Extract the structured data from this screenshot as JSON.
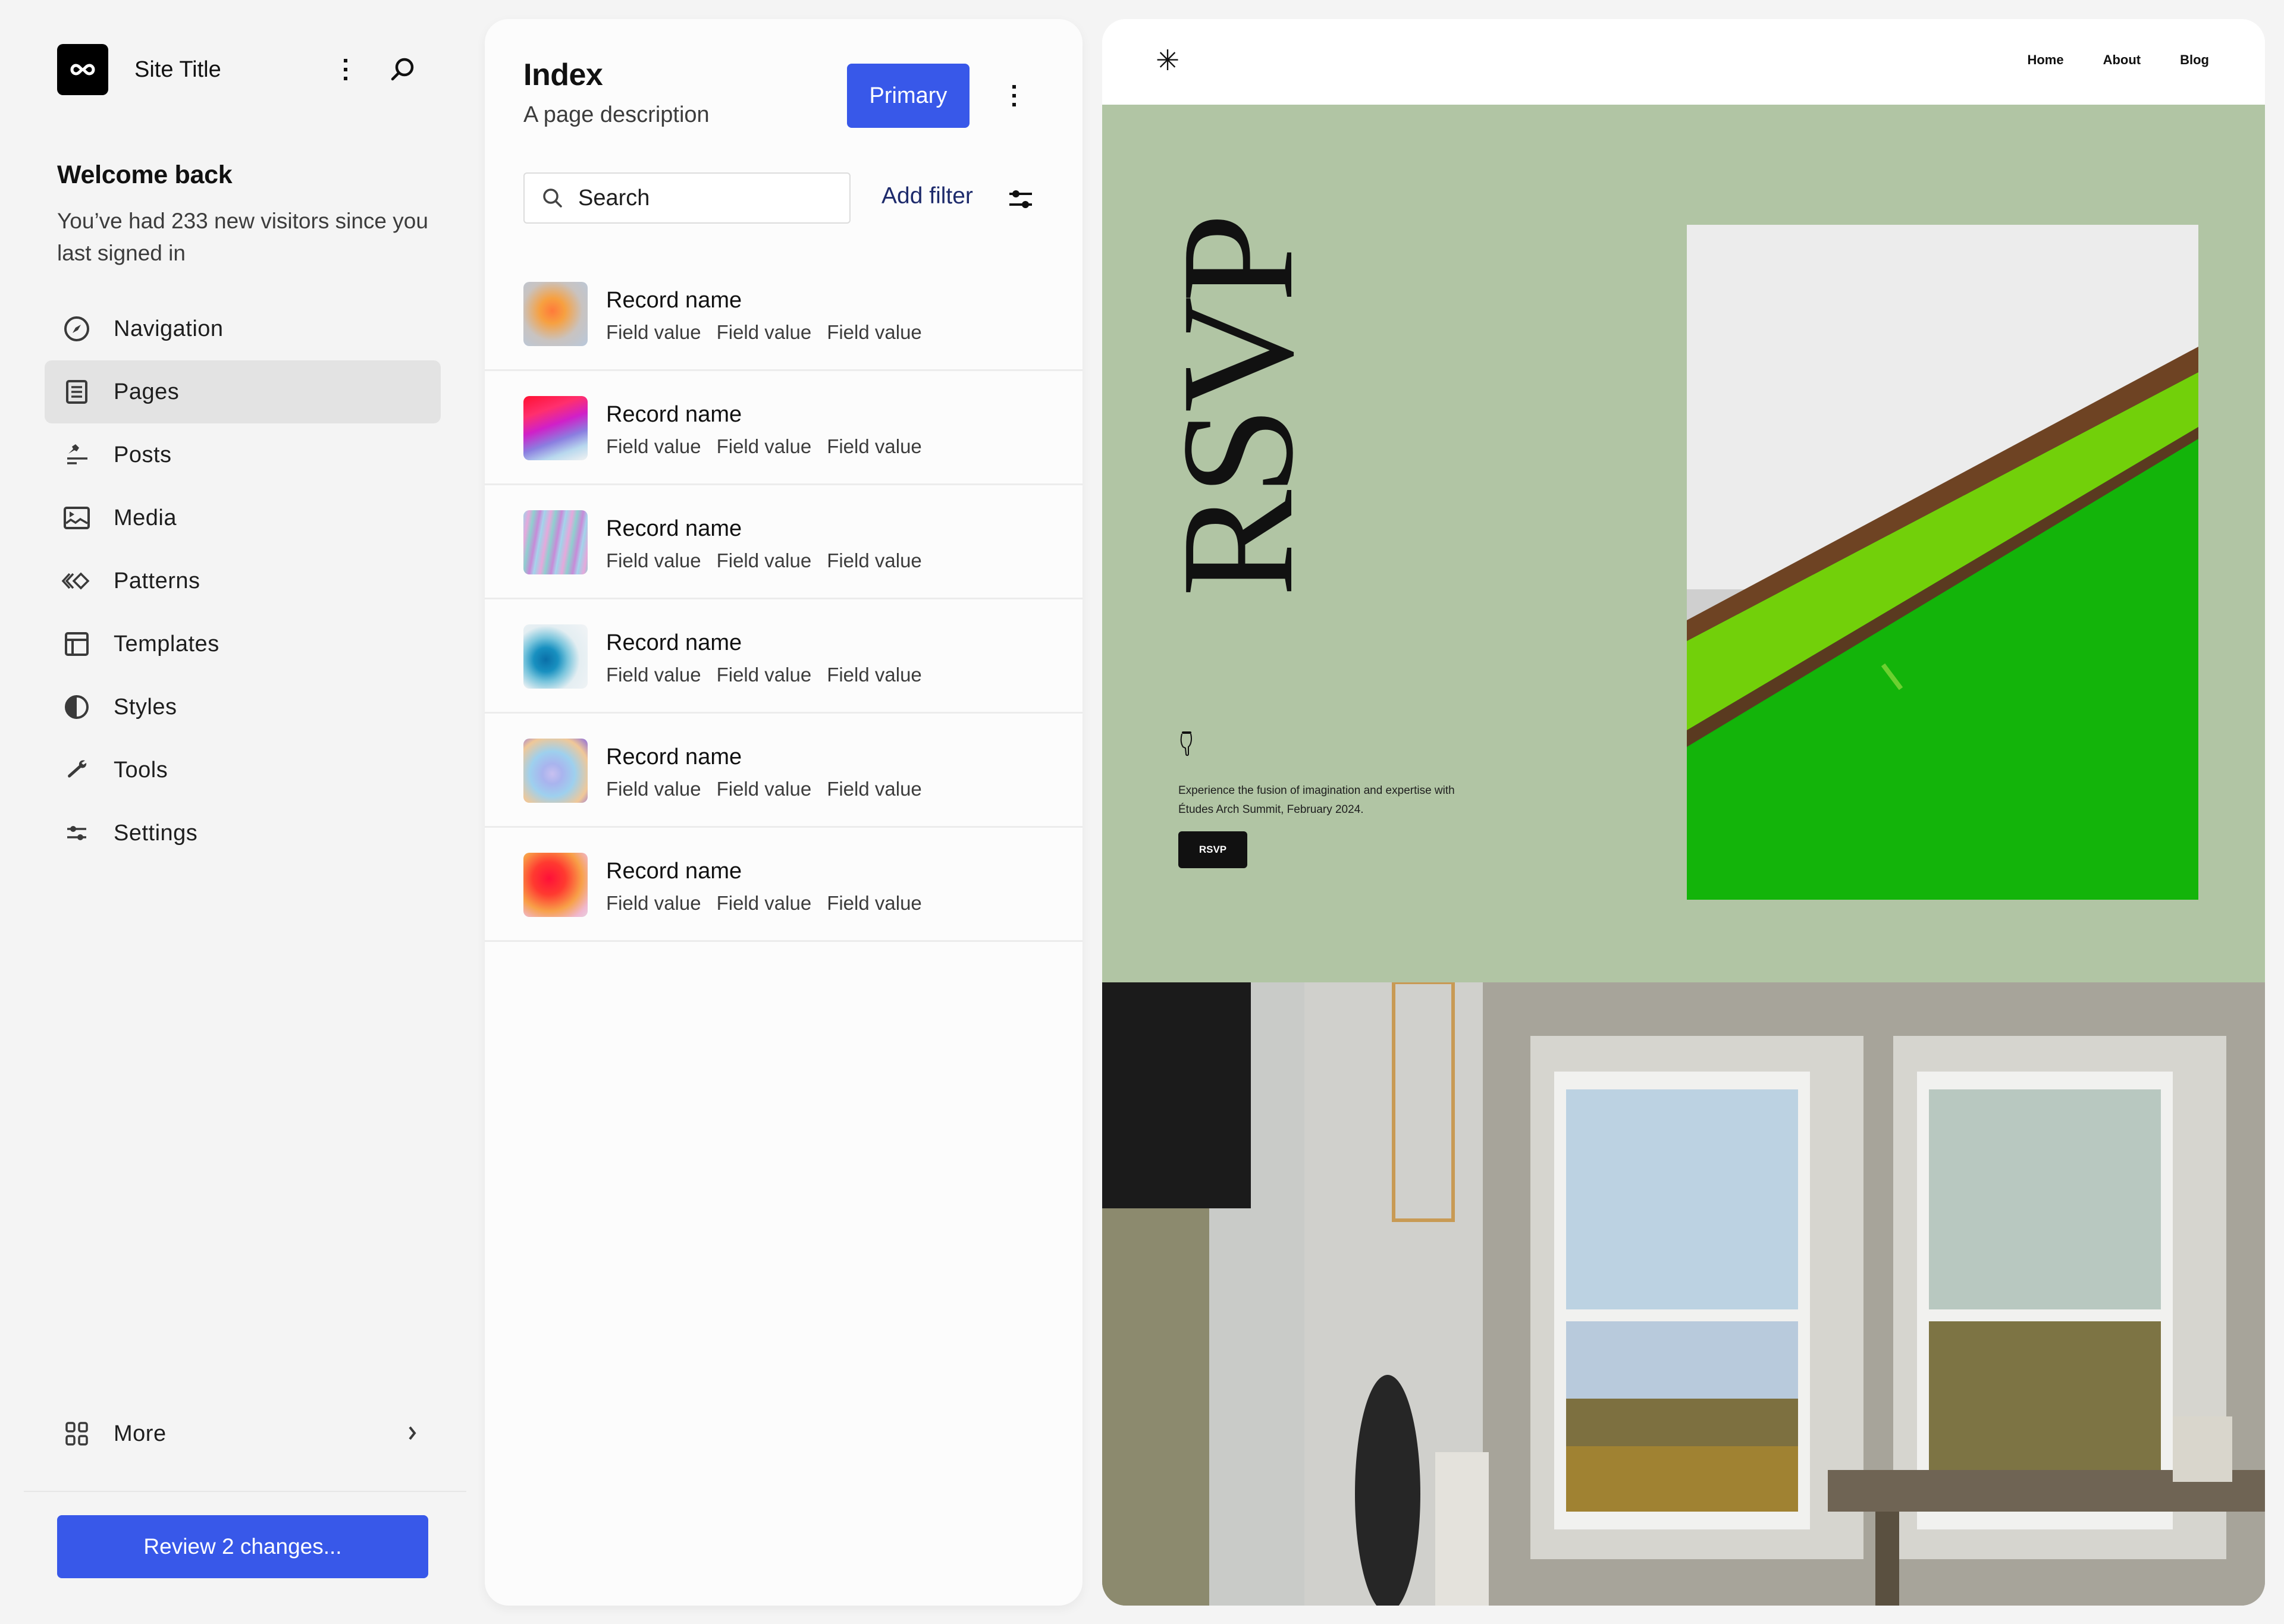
{
  "sidebar": {
    "site_title": "Site Title",
    "logo_icon": "infinity-icon",
    "welcome_title": "Welcome back",
    "welcome_text": "You’ve had 233 new visitors since you last signed in",
    "nav_items": [
      {
        "label": "Navigation",
        "icon": "compass-icon",
        "active": false
      },
      {
        "label": "Pages",
        "icon": "page-icon",
        "active": true
      },
      {
        "label": "Posts",
        "icon": "pin-icon",
        "active": false
      },
      {
        "label": "Media",
        "icon": "image-icon",
        "active": false
      },
      {
        "label": "Patterns",
        "icon": "symbol-icon",
        "active": false
      },
      {
        "label": "Templates",
        "icon": "layout-icon",
        "active": false
      },
      {
        "label": "Styles",
        "icon": "half-circle-icon",
        "active": false
      },
      {
        "label": "Tools",
        "icon": "wrench-icon",
        "active": false
      },
      {
        "label": "Settings",
        "icon": "sliders-icon",
        "active": false
      }
    ],
    "more_label": "More",
    "review_button": "Review 2 changes..."
  },
  "panel": {
    "title": "Index",
    "description": "A page description",
    "primary_button": "Primary",
    "search_placeholder": "Search",
    "search_value": "",
    "add_filter": "Add filter",
    "records": [
      {
        "name": "Record name",
        "fields": [
          "Field value",
          "Field value",
          "Field value"
        ]
      },
      {
        "name": "Record name",
        "fields": [
          "Field value",
          "Field value",
          "Field value"
        ]
      },
      {
        "name": "Record name",
        "fields": [
          "Field value",
          "Field value",
          "Field value"
        ]
      },
      {
        "name": "Record name",
        "fields": [
          "Field value",
          "Field value",
          "Field value"
        ]
      },
      {
        "name": "Record name",
        "fields": [
          "Field value",
          "Field value",
          "Field value"
        ]
      },
      {
        "name": "Record name",
        "fields": [
          "Field value",
          "Field value",
          "Field value"
        ]
      }
    ]
  },
  "preview": {
    "logo_glyph": "✳",
    "nav": [
      "Home",
      "About",
      "Blog"
    ],
    "hero_heading": "RSVP",
    "hero_text": "Experience the fusion of imagination and expertise with Études Arch Summit, February 2024.",
    "hero_button": "RSVP",
    "hero_bg_color": "#b1c5a4"
  },
  "colors": {
    "accent": "#3858e9",
    "link": "#1d2a6b",
    "sidebar_bg": "#f4f4f4",
    "active_nav_bg": "#e3e3e3"
  }
}
